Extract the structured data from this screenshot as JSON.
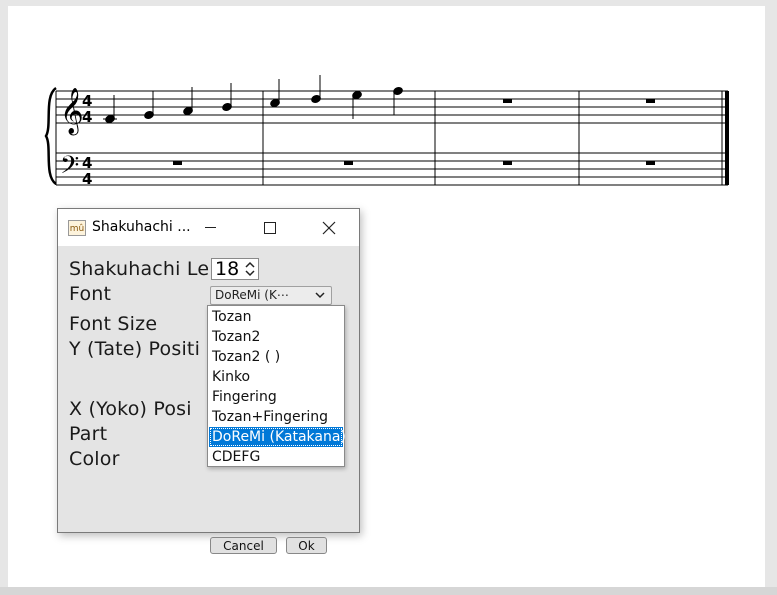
{
  "score": {
    "time_signature": {
      "top": "4",
      "bottom": "4"
    }
  },
  "dialog": {
    "title": "Shakuhachi ...",
    "icon_label": "mû",
    "fields": {
      "length_label": "Shakuhachi Le",
      "length_value": "18",
      "font_label": "Font",
      "font_selected": "DoReMi (K⋯",
      "font_size_label": "Font Size",
      "y_position_label": "Y (Tate) Positi",
      "x_position_label": "X (Yoko)  Posi",
      "part_label": "Part",
      "color_label": "Color"
    },
    "font_options": [
      "Tozan",
      "Tozan2",
      "Tozan2 ( )",
      "Kinko",
      "Fingering",
      "Tozan+Fingering",
      "DoReMi (Katakana)",
      "CDEFG"
    ],
    "font_options_selected_index": 6,
    "buttons": {
      "cancel": "Cancel",
      "ok": "Ok"
    }
  }
}
